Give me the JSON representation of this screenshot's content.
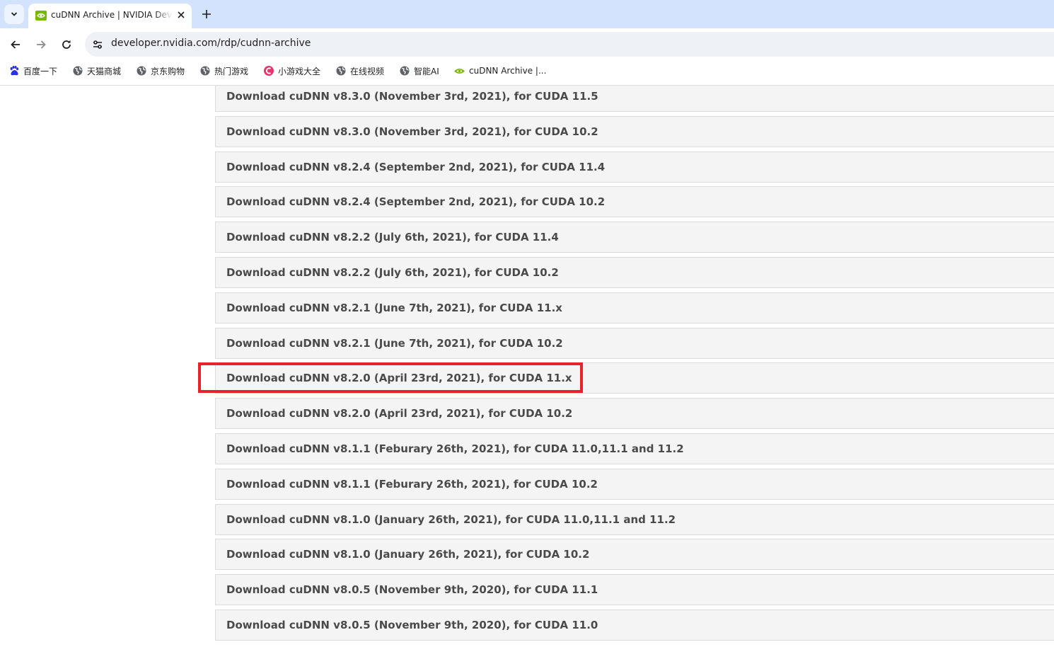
{
  "browser": {
    "tab": {
      "title": "cuDNN Archive | NVIDIA Developer"
    },
    "address_bar": {
      "url": "developer.nvidia.com/rdp/cudnn-archive"
    },
    "bookmarks": [
      {
        "label": "百度一下",
        "icon": "baidu-paw-icon"
      },
      {
        "label": "天猫商城",
        "icon": "globe-icon"
      },
      {
        "label": "京东购物",
        "icon": "globe-icon"
      },
      {
        "label": "热门游戏",
        "icon": "globe-icon"
      },
      {
        "label": "小游戏大全",
        "icon": "game-icon"
      },
      {
        "label": "在线视频",
        "icon": "globe-icon"
      },
      {
        "label": "智能AI",
        "icon": "globe-icon"
      },
      {
        "label": "cuDNN Archive |...",
        "icon": "nvidia-icon"
      }
    ]
  },
  "downloads": [
    "Download cuDNN v8.3.0 (November 3rd, 2021), for CUDA 11.5",
    "Download cuDNN v8.3.0 (November 3rd, 2021), for CUDA 10.2",
    "Download cuDNN v8.2.4 (September 2nd, 2021), for CUDA 11.4",
    "Download cuDNN v8.2.4 (September 2nd, 2021), for CUDA 10.2",
    "Download cuDNN v8.2.2 (July 6th, 2021), for CUDA 11.4",
    "Download cuDNN v8.2.2 (July 6th, 2021), for CUDA 10.2",
    "Download cuDNN v8.2.1 (June 7th, 2021), for CUDA 11.x",
    "Download cuDNN v8.2.1 (June 7th, 2021), for CUDA 10.2",
    "Download cuDNN v8.2.0 (April 23rd, 2021), for CUDA 11.x",
    "Download cuDNN v8.2.0 (April 23rd, 2021), for CUDA 10.2",
    "Download cuDNN v8.1.1 (Feburary 26th, 2021), for CUDA 11.0,11.1 and 11.2",
    "Download cuDNN v8.1.1 (Feburary 26th, 2021), for CUDA 10.2",
    "Download cuDNN v8.1.0 (January 26th, 2021), for CUDA 11.0,11.1 and 11.2",
    "Download cuDNN v8.1.0 (January 26th, 2021), for CUDA 10.2",
    "Download cuDNN v8.0.5 (November 9th, 2020), for CUDA 11.1",
    "Download cuDNN v8.0.5 (November 9th, 2020), for CUDA 11.0"
  ],
  "highlighted_item": 8,
  "colors": {
    "nvidia_green": "#76b900",
    "highlight_red": "#e8212b",
    "tabstrip": "#d3e3fd",
    "item_background": "#f4f4f4"
  }
}
